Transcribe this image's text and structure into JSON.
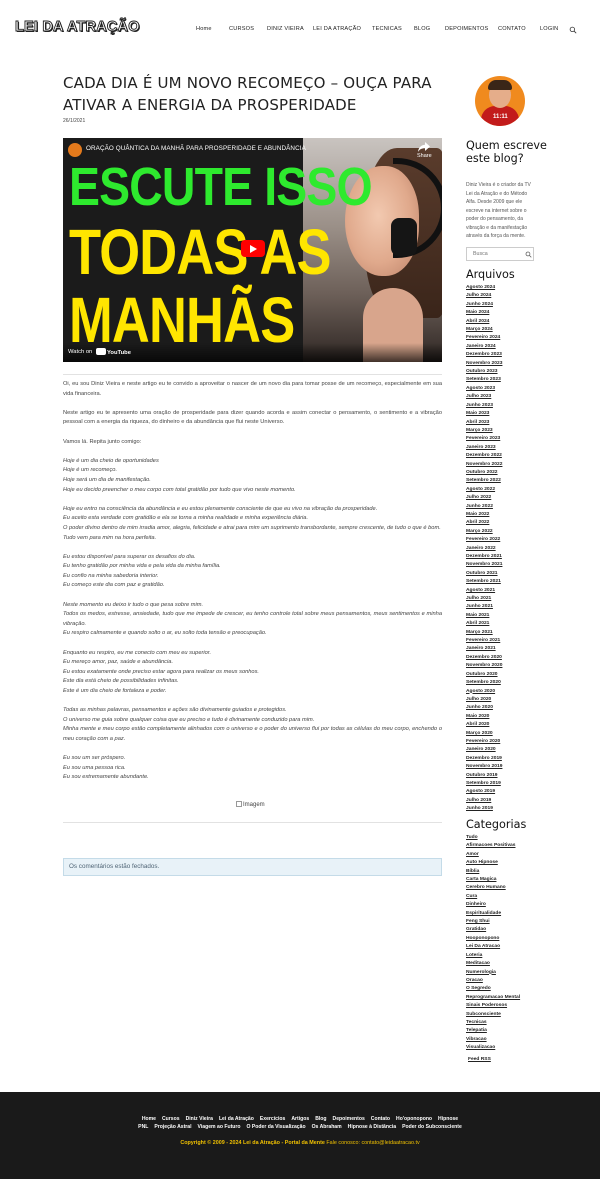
{
  "header": {
    "logo": "LEI DA ATRAÇÃO",
    "nav": [
      "Home",
      "CURSOS",
      "DINIZ VIEIRA",
      "LEI DA ATRAÇÃO",
      "TECNICAS",
      "BLOG",
      "DEPOIMENTOS",
      "CONTATO",
      "LOGIN"
    ],
    "search_icon": "search-icon"
  },
  "post": {
    "title": "CADA DIA É UM NOVO RECOMEÇO – OUÇA PARA ATIVAR A ENERGIA DA PROSPERIDADE",
    "date": "26/1/2021",
    "video": {
      "title": "ORAÇÃO QUÂNTICA DA MANHÃ PARA PROSPERIDADE E ABUNDÂNCIA",
      "share": "Share",
      "line1": "ESCUTE ISSO",
      "line2": "TODAS AS",
      "line3": "MANHÃS",
      "watch_on": "Watch on",
      "youtube": "YouTube",
      "colors": {
        "green": "#2eea2e",
        "yellow": "#ffe600",
        "play": "#ff0000"
      }
    },
    "paragraphs": [
      {
        "text": "Oi, eu sou Diniz Vieira e neste artigo eu te convido a aproveitar o nascer de um novo dia para tomar posse de um recomeço, especialmente em sua vida financeira.",
        "italic": false
      },
      {
        "text": "Neste artigo eu te apresento uma oração de prosperidade para dizer quando acorda e assim conectar o pensamento, o sentimento e a vibração pessoal com a energia da riqueza, do dinheiro e da abundância que flui neste Universo.",
        "italic": false
      },
      {
        "text": "Vamos lá. Repita junto comigo:",
        "italic": false
      },
      {
        "text": "Hoje é um dia cheio de oportunidades\nHoje é um recomeço.\nHoje será um dia de manifestação.\nHoje eu decido preencher o meu corpo com total gratidão por tudo que vivo neste momento.",
        "italic": true
      },
      {
        "text": "Hoje eu entro na consciência da abundância e eu estou plenamente consciente de que eu vivo na vibração da prosperidade.\nEu aceito esta verdade com gratidão e ela se torna a minha realidade e minha experiência diária.\nO poder divino dentro de mim irradia amor, alegria, felicidade e atrai para mim um suprimento transbordante, sempre crescente, de tudo o que é bom.\nTudo vem para mim na hora perfeita.",
        "italic": true
      },
      {
        "text": "Eu estou disponível para superar os desafios do dia.\nEu tenho gratidão por minha vida e pela vida da minha família.\nEu confio na minha sabedoria interior.\nEu começo este dia com paz e gratidão.",
        "italic": true
      },
      {
        "text": "Neste momento eu deixo ir tudo o que pesa sobre mim.\nTodos os medos, estresse, ansiedade, tudo que me impede de crescer, eu tenho controle total sobre meus pensamentos, meus sentimentos e minha vibração.\nEu respiro calmamente e quando solto o ar, eu solto toda tensão e preocupação.",
        "italic": true
      },
      {
        "text": "Enquanto eu respiro, eu me conecto com meu eu superior.\nEu mereço amor, paz, saúde e abundância.\nEu estou exatamente onde preciso estar agora para realizar os meus sonhos.\nEste dia está cheio de possibilidades infinitas.\nEste é um dia cheio de fortaleza e poder.",
        "italic": true
      },
      {
        "text": "Todas as minhas palavras, pensamentos e ações são divinamente guiados e protegidos.\nO universo me guia sobre qualquer coisa que eu preciso e tudo é divinamente conduzido para mim.\nMinha mente e meu corpo estão completamente alinhados com o universo e o poder do universo flui por todas as células do meu corpo, enchendo o meu coração com a paz.",
        "italic": true
      },
      {
        "text": "Eu sou um ser próspero.\nEu sou uma pessoa rica.\nEu sou extremamente abundante.",
        "italic": true
      }
    ],
    "image_alt": "Imagem",
    "comments_closed": "Os comentários estão fechados."
  },
  "sidebar": {
    "who_title": "Quem escreve este blog?",
    "who_text": "Diniz Vieira é o criador da TV Lei da Atração e do Método Alfa. Desde 2009 que ele escreve na internet sobre o poder do pensamento, da vibração e da manifestação através da força da mente.",
    "avatar_badge": "11:11",
    "search_placeholder": "Busca",
    "archives_title": "Arquivos",
    "archives": [
      "Agosto 2024",
      "Julho 2024",
      "Junho 2024",
      "Maio 2024",
      "Abril 2024",
      "Março 2024",
      "Fevereiro 2024",
      "Janeiro 2024",
      "Dezembro 2023",
      "Novembro 2023",
      "Outubro 2023",
      "Setembro 2023",
      "Agosto 2023",
      "Julho 2023",
      "Junho 2023",
      "Maio 2023",
      "Abril 2023",
      "Março 2023",
      "Fevereiro 2023",
      "Janeiro 2023",
      "Dezembro 2022",
      "Novembro 2022",
      "Outubro 2022",
      "Setembro 2022",
      "Agosto 2022",
      "Julho 2022",
      "Junho 2022",
      "Maio 2022",
      "Abril 2022",
      "Março 2022",
      "Fevereiro 2022",
      "Janeiro 2022",
      "Dezembro 2021",
      "Novembro 2021",
      "Outubro 2021",
      "Setembro 2021",
      "Agosto 2021",
      "Julho 2021",
      "Junho 2021",
      "Maio 2021",
      "Abril 2021",
      "Março 2021",
      "Fevereiro 2021",
      "Janeiro 2021",
      "Dezembro 2020",
      "Novembro 2020",
      "Outubro 2020",
      "Setembro 2020",
      "Agosto 2020",
      "Julho 2020",
      "Junho 2020",
      "Maio 2020",
      "Abril 2020",
      "Março 2020",
      "Fevereiro 2020",
      "Janeiro 2020",
      "Dezembro 2019",
      "Novembro 2019",
      "Outubro 2019",
      "Setembro 2019",
      "Agosto 2019",
      "Julho 2019",
      "Junho 2019"
    ],
    "categories_title": "Categorias",
    "categories": [
      "Tudo",
      "Afirmacoes Positivas",
      "Amor",
      "Auto Hipnose",
      "Bíblia",
      "Carta Magica",
      "Cerebro Humano",
      "Cura",
      "Dinheiro",
      "Espiritualidade",
      "Feng Shui",
      "Gratidao",
      "Hooponopono",
      "Lei Da Atracao",
      "Loteria",
      "Meditacao",
      "Numerologia",
      "Oracao",
      "O Segredo",
      "Reprogramacao Mental",
      "Sinais Poderosos",
      "Subconsciente",
      "Tecnicas",
      "Telepatia",
      "Vibracao",
      "Visualizacao"
    ],
    "feed": "Feed RSS"
  },
  "footer": {
    "row1": [
      "Home",
      "Cursos",
      "Diniz Vieira",
      "Lei da Atração",
      "Exercícios",
      "Artigos",
      "Blog",
      "Depoimentos",
      "Contato",
      "Ho'oponopono",
      "Hipnose"
    ],
    "row2": [
      "PNL",
      "Projeção Astral",
      "Viagem ao Futuro",
      "O Poder da Visualização",
      "Os Abraham",
      "Hipnose à Distância",
      "Poder do Subconsciente"
    ],
    "copyright": "Copyright © 2009 - 2024 Lei da Atração - Portal da Mente",
    "contact": "Fale conosco: contato@leidaatracao.tv"
  }
}
